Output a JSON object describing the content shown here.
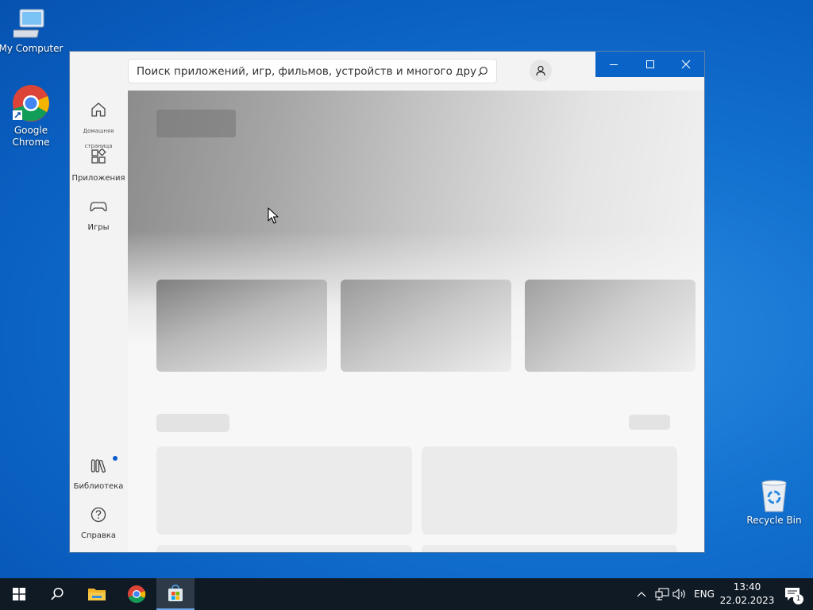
{
  "desktop": {
    "icons": [
      {
        "label": "My Computer"
      },
      {
        "label": "Google Chrome"
      },
      {
        "label": "Recycle Bin"
      }
    ]
  },
  "store_window": {
    "search": {
      "placeholder": "Поиск приложений, игр, фильмов, устройств и многого другого"
    },
    "nav": {
      "home": "Домашняя страница",
      "apps": "Приложения",
      "games": "Игры",
      "library": "Библиотека",
      "help": "Справка"
    },
    "content_state": "loading"
  },
  "taskbar": {
    "pinned": [
      "start-icon",
      "search-icon",
      "file-explorer-icon",
      "chrome-icon",
      "microsoft-store-icon"
    ],
    "active": "microsoft-store-icon",
    "tray": {
      "language": "ENG",
      "time": "13:40",
      "date": "22.02.2023",
      "notification_count": "1"
    }
  },
  "colors": {
    "desktop_blue": "#1371cf",
    "taskbar": "#101a25",
    "titlebar_buttons": "#0a64c8",
    "library_dot": "#0a5bd0"
  }
}
